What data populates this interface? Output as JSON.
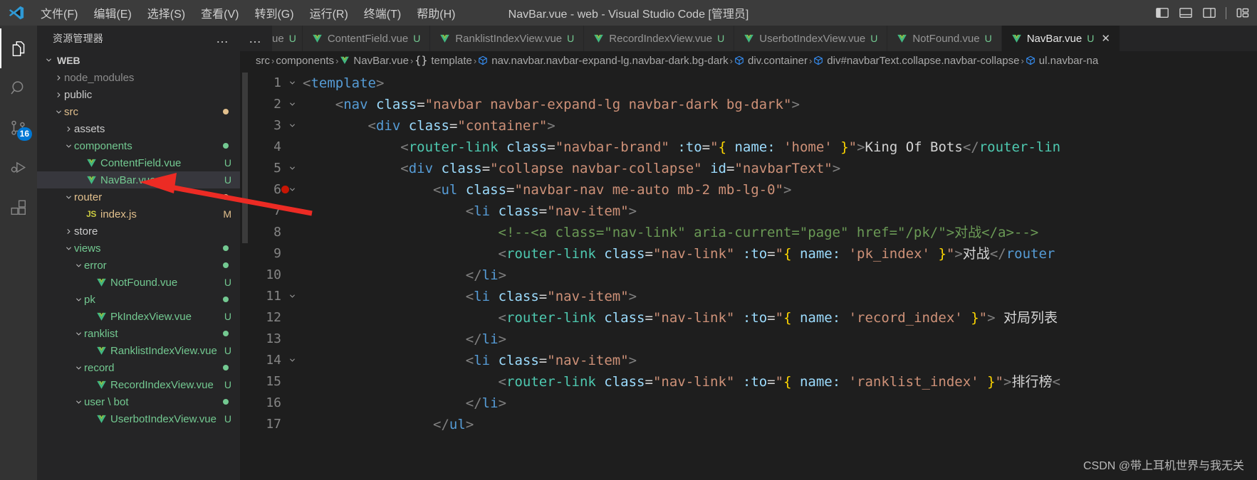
{
  "window": {
    "title": "NavBar.vue - web - Visual Studio Code [管理员]",
    "logo_icon": "vscode-logo-icon"
  },
  "menubar": {
    "items": [
      {
        "label": "文件(F)",
        "name": "menu-file"
      },
      {
        "label": "编辑(E)",
        "name": "menu-edit"
      },
      {
        "label": "选择(S)",
        "name": "menu-selection"
      },
      {
        "label": "查看(V)",
        "name": "menu-view"
      },
      {
        "label": "转到(G)",
        "name": "menu-go"
      },
      {
        "label": "运行(R)",
        "name": "menu-run"
      },
      {
        "label": "终端(T)",
        "name": "menu-terminal"
      },
      {
        "label": "帮助(H)",
        "name": "menu-help"
      }
    ]
  },
  "layout_controls": [
    {
      "name": "toggle-primary-sidebar-icon"
    },
    {
      "name": "toggle-panel-icon"
    },
    {
      "name": "toggle-secondary-sidebar-icon"
    },
    {
      "name": "customize-layout-icon"
    }
  ],
  "activitybar": {
    "items": [
      {
        "name": "explorer-icon",
        "label": "资源管理器",
        "active": true,
        "badge": ""
      },
      {
        "name": "search-icon",
        "label": "搜索",
        "active": false,
        "badge": ""
      },
      {
        "name": "source-control-icon",
        "label": "源代码管理",
        "active": false,
        "badge": "16"
      },
      {
        "name": "run-and-debug-icon",
        "label": "运行和调试",
        "active": false,
        "badge": ""
      },
      {
        "name": "extensions-icon",
        "label": "扩展",
        "active": false,
        "badge": ""
      }
    ]
  },
  "sidebar": {
    "title": "资源管理器",
    "ellipsis": "…",
    "root_label": "WEB",
    "tree": [
      {
        "label": "node_modules",
        "indent": 1,
        "type": "folder",
        "state": "collapsed",
        "color": "#8c8c8c",
        "status": "",
        "dot": ""
      },
      {
        "label": "public",
        "indent": 1,
        "type": "folder",
        "state": "collapsed",
        "color": "#cccccc",
        "status": "",
        "dot": ""
      },
      {
        "label": "src",
        "indent": 1,
        "type": "folder",
        "state": "expanded",
        "color": "#e2c08d",
        "status": "",
        "dot": "#e2c08d"
      },
      {
        "label": "assets",
        "indent": 2,
        "type": "folder",
        "state": "collapsed",
        "color": "#cccccc",
        "status": "",
        "dot": ""
      },
      {
        "label": "components",
        "indent": 2,
        "type": "folder",
        "state": "expanded",
        "color": "#73c991",
        "status": "",
        "dot": "#73c991"
      },
      {
        "label": "ContentField.vue",
        "indent": 3,
        "type": "vue",
        "state": "none",
        "color": "#73c991",
        "status": "U",
        "dot": ""
      },
      {
        "label": "NavBar.vue",
        "indent": 3,
        "type": "vue",
        "state": "none",
        "color": "#73c991",
        "status": "U",
        "dot": "",
        "selected": true
      },
      {
        "label": "router",
        "indent": 2,
        "type": "folder",
        "state": "expanded",
        "color": "#e2c08d",
        "status": "",
        "dot": "#e2c08d"
      },
      {
        "label": "index.js",
        "indent": 3,
        "type": "js",
        "state": "none",
        "color": "#e2c08d",
        "status": "M",
        "dot": ""
      },
      {
        "label": "store",
        "indent": 2,
        "type": "folder",
        "state": "collapsed",
        "color": "#cccccc",
        "status": "",
        "dot": ""
      },
      {
        "label": "views",
        "indent": 2,
        "type": "folder",
        "state": "expanded",
        "color": "#73c991",
        "status": "",
        "dot": "#73c991"
      },
      {
        "label": "error",
        "indent": 3,
        "type": "folder",
        "state": "expanded",
        "color": "#73c991",
        "status": "",
        "dot": "#73c991"
      },
      {
        "label": "NotFound.vue",
        "indent": 4,
        "type": "vue",
        "state": "none",
        "color": "#73c991",
        "status": "U",
        "dot": ""
      },
      {
        "label": "pk",
        "indent": 3,
        "type": "folder",
        "state": "expanded",
        "color": "#73c991",
        "status": "",
        "dot": "#73c991"
      },
      {
        "label": "PkIndexView.vue",
        "indent": 4,
        "type": "vue",
        "state": "none",
        "color": "#73c991",
        "status": "U",
        "dot": ""
      },
      {
        "label": "ranklist",
        "indent": 3,
        "type": "folder",
        "state": "expanded",
        "color": "#73c991",
        "status": "",
        "dot": "#73c991"
      },
      {
        "label": "RanklistIndexView.vue",
        "indent": 4,
        "type": "vue",
        "state": "none",
        "color": "#73c991",
        "status": "U",
        "dot": ""
      },
      {
        "label": "record",
        "indent": 3,
        "type": "folder",
        "state": "expanded",
        "color": "#73c991",
        "status": "",
        "dot": "#73c991"
      },
      {
        "label": "RecordIndexView.vue",
        "indent": 4,
        "type": "vue",
        "state": "none",
        "color": "#73c991",
        "status": "U",
        "dot": ""
      },
      {
        "label": "user \\ bot",
        "indent": 3,
        "type": "folder",
        "state": "expanded",
        "color": "#73c991",
        "status": "",
        "dot": "#73c991"
      },
      {
        "label": "UserbotIndexView.vue",
        "indent": 4,
        "type": "vue",
        "state": "none",
        "color": "#73c991",
        "status": "U",
        "dot": ""
      }
    ]
  },
  "tabs": {
    "overflow_icon": "…",
    "partial_label": "ue",
    "partial_status": "U",
    "items": [
      {
        "label": "ContentField.vue",
        "status": "U",
        "active": false
      },
      {
        "label": "RanklistIndexView.vue",
        "status": "U",
        "active": false
      },
      {
        "label": "RecordIndexView.vue",
        "status": "U",
        "active": false
      },
      {
        "label": "UserbotIndexView.vue",
        "status": "U",
        "active": false
      },
      {
        "label": "NotFound.vue",
        "status": "U",
        "active": false
      },
      {
        "label": "NavBar.vue",
        "status": "U",
        "active": true,
        "close": "✕"
      }
    ]
  },
  "breadcrumbs": {
    "separator": "›",
    "items": [
      {
        "label": "src",
        "icon": ""
      },
      {
        "label": "components",
        "icon": ""
      },
      {
        "label": "NavBar.vue",
        "icon": "vue-file-icon"
      },
      {
        "label": "template",
        "icon": "braces-icon"
      },
      {
        "label": "nav.navbar.navbar-expand-lg.navbar-dark.bg-dark",
        "icon": "symbol-field-icon"
      },
      {
        "label": "div.container",
        "icon": "symbol-field-icon"
      },
      {
        "label": "div#navbarText.collapse.navbar-collapse",
        "icon": "symbol-field-icon"
      },
      {
        "label": "ul.navbar-na",
        "icon": "symbol-field-icon"
      }
    ]
  },
  "code": {
    "lines": [
      {
        "num": "1",
        "fold": "down",
        "breakpoint": false
      },
      {
        "num": "2",
        "fold": "down",
        "breakpoint": false
      },
      {
        "num": "3",
        "fold": "down",
        "breakpoint": false
      },
      {
        "num": "4",
        "fold": "",
        "breakpoint": false
      },
      {
        "num": "5",
        "fold": "down",
        "breakpoint": false
      },
      {
        "num": "6",
        "fold": "down",
        "breakpoint": true
      },
      {
        "num": "7",
        "fold": "down",
        "breakpoint": false
      },
      {
        "num": "8",
        "fold": "",
        "breakpoint": false
      },
      {
        "num": "9",
        "fold": "",
        "breakpoint": false
      },
      {
        "num": "10",
        "fold": "",
        "breakpoint": false
      },
      {
        "num": "11",
        "fold": "down",
        "breakpoint": false
      },
      {
        "num": "12",
        "fold": "",
        "breakpoint": false
      },
      {
        "num": "13",
        "fold": "",
        "breakpoint": false
      },
      {
        "num": "14",
        "fold": "down",
        "breakpoint": false
      },
      {
        "num": "15",
        "fold": "",
        "breakpoint": false
      },
      {
        "num": "16",
        "fold": "",
        "breakpoint": false
      },
      {
        "num": "17",
        "fold": "",
        "breakpoint": false
      }
    ],
    "source_text": [
      "<template>",
      "    <nav class=\"navbar navbar-expand-lg navbar-dark bg-dark\">",
      "        <div class=\"container\">",
      "            <router-link class=\"navbar-brand\" :to=\"{ name: 'home' }\">King Of Bots</router-lin",
      "            <div class=\"collapse navbar-collapse\" id=\"navbarText\">",
      "                <ul class=\"navbar-nav me-auto mb-2 mb-lg-0\">",
      "                    <li class=\"nav-item\">",
      "                        <!--<a class=\"nav-link\" aria-current=\"page\" href=\"/pk/\">对战</a>-->",
      "                        <router-link class=\"nav-link\" :to=\"{ name: 'pk_index' }\">对战</router",
      "                    </li>",
      "                    <li class=\"nav-item\">",
      "                        <router-link class=\"nav-link\" :to=\"{ name: 'record_index' }\"> 对局列表",
      "                    </li>",
      "                    <li class=\"nav-item\">",
      "                        <router-link class=\"nav-link\" :to=\"{ name: 'ranklist_index' }\">排行榜<",
      "                    </li>",
      "                </ul>"
    ]
  },
  "watermark": {
    "text": "CSDN @带上耳机世界与我无关"
  },
  "colors": {
    "titlebar_bg": "#3c3c3c",
    "activitybar_bg": "#333333",
    "sidebar_bg": "#252526",
    "editor_bg": "#1e1e1e",
    "accent_badge": "#0078d4",
    "git_untracked": "#73c991",
    "git_modified": "#e2c08d",
    "arrow": "#ec2b24",
    "selection_row": "#37373d"
  }
}
